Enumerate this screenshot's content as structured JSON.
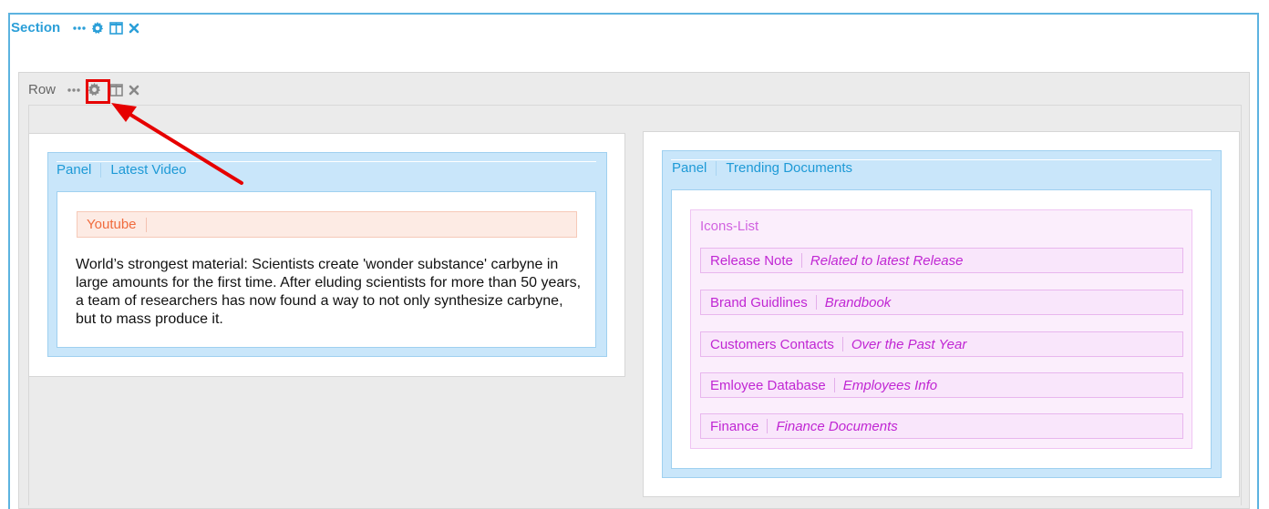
{
  "section": {
    "title": "Section",
    "icons": [
      "ellipsis-icon",
      "gear-icon",
      "columns-icon",
      "close-icon"
    ]
  },
  "row": {
    "title": "Row",
    "icons": [
      "ellipsis-icon",
      "gear-icon",
      "columns-icon",
      "close-icon"
    ]
  },
  "left_panel": {
    "type_label": "Panel",
    "title": "Latest Video",
    "widget_label": "Youtube",
    "text": "World’s strongest material: Scientists create 'wonder substance' carbyne in large amounts for the first time. After eluding scientists for more than 50 years, a team of researchers has now found a way to not only synthesize carbyne, but to mass produce it."
  },
  "right_panel": {
    "type_label": "Panel",
    "title": "Trending Documents",
    "list_title": "Icons-List",
    "items": [
      {
        "name": "Release Note",
        "desc": "Related to latest Release"
      },
      {
        "name": "Brand Guidlines",
        "desc": "Brandbook"
      },
      {
        "name": "Customers Contacts",
        "desc": "Over the Past Year"
      },
      {
        "name": "Emloyee Database",
        "desc": "Employees Info"
      },
      {
        "name": "Finance",
        "desc": "Finance Documents"
      }
    ]
  },
  "colors": {
    "section_accent": "#2b9fd8",
    "panel_bg": "#c9e6fa",
    "youtube_accent": "#f06b3d",
    "list_accent": "#c026d3",
    "annotation": "#e60000"
  }
}
